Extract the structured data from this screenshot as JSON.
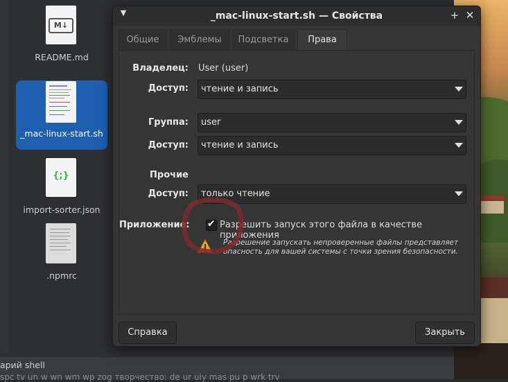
{
  "desktop": {
    "files": [
      {
        "name": "README.md",
        "icon": "markdown-file-icon"
      },
      {
        "name": "_mac-linux-start.sh",
        "icon": "shell-script-icon"
      },
      {
        "name": "import-sorter.json",
        "icon": "json-file-icon"
      },
      {
        "name": ".npmrc",
        "icon": "text-file-icon"
      }
    ],
    "markdown_glyph": "M↓",
    "json_glyph": "{;}",
    "status_line": "арий shell",
    "status_line2": "spc  tv  un  w  wn  wm  wp  zog творчество:  de  ur  uiy  mas  pu  p  wrk  trv"
  },
  "dialog": {
    "title": "_mac-linux-start.sh — Свойства",
    "menu_icon": "chevron-down-icon",
    "tabs": [
      "Общие",
      "Эмблемы",
      "Подсветка",
      "Права"
    ],
    "active_tab": "Права",
    "owner": {
      "label": "Владелец:",
      "value": "User (user)"
    },
    "owner_access": {
      "label": "Доступ:",
      "value": "чтение и запись"
    },
    "group": {
      "label": "Группа:",
      "value": "user"
    },
    "group_access": {
      "label": "Доступ:",
      "value": "чтение и запись"
    },
    "others": {
      "label": "Прочие"
    },
    "others_access": {
      "label": "Доступ:",
      "value": "только чтение"
    },
    "application": {
      "label": "Приложение:",
      "checkbox_text": "Разрешить запуск этого файла в качестве приложения",
      "checked": true,
      "warning_line1": "Разрешение запускать непроверенные файлы представляет",
      "warning_line2": "опасность для вашей системы с точки зрения безопасности."
    },
    "buttons": {
      "help": "Справка",
      "close": "Закрыть"
    }
  },
  "colors": {
    "selection": "#1e5fb0",
    "dialog_bg": "#353535",
    "warning": "#f0a020",
    "annotation": "#7a2a2e"
  }
}
